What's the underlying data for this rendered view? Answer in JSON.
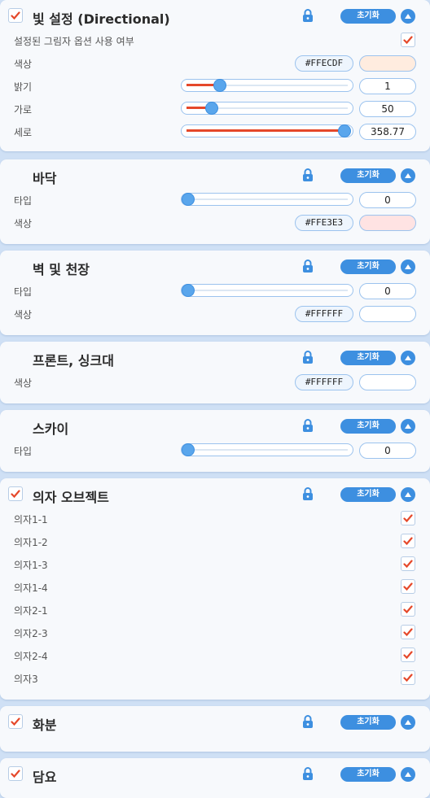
{
  "reset_label": "초기화",
  "lighting": {
    "title": "빛 설정 (Directional)",
    "enabled": true,
    "shadow_option_label": "설정된 그림자 옵션 사용 여부",
    "shadow_option_checked": true,
    "color_label": "색상",
    "color_hex": "#FFECDF",
    "brightness_label": "밝기",
    "brightness_value": "1",
    "horizontal_label": "가로",
    "horizontal_value": "50",
    "vertical_label": "세로",
    "vertical_value": "358.77"
  },
  "floor": {
    "title": "바닥",
    "type_label": "타입",
    "type_value": "0",
    "color_label": "색상",
    "color_hex": "#FFE3E3"
  },
  "wall": {
    "title": "벽 및 천장",
    "type_label": "타입",
    "type_value": "0",
    "color_label": "색상",
    "color_hex": "#FFFFFF"
  },
  "front": {
    "title": "프론트, 싱크대",
    "color_label": "색상",
    "color_hex": "#FFFFFF"
  },
  "sky": {
    "title": "스카이",
    "type_label": "타입",
    "type_value": "0"
  },
  "chairs": {
    "title": "의자 오브젝트",
    "enabled": true,
    "items": [
      {
        "label": "의자1-1",
        "checked": true
      },
      {
        "label": "의자1-2",
        "checked": true
      },
      {
        "label": "의자1-3",
        "checked": true
      },
      {
        "label": "의자1-4",
        "checked": true
      },
      {
        "label": "의자2-1",
        "checked": true
      },
      {
        "label": "의자2-3",
        "checked": true
      },
      {
        "label": "의자2-4",
        "checked": true
      },
      {
        "label": "의자3",
        "checked": true
      }
    ]
  },
  "flowerpot": {
    "title": "화분",
    "enabled": true
  },
  "fence": {
    "title": "담요",
    "enabled": true
  },
  "colors": {
    "accent": "#3D8FE0",
    "slider_fill": "#E5482A",
    "check": "#E5482A"
  },
  "slider_levels": {
    "brightness": 0.19,
    "horizontal": 0.14,
    "vertical": 1.0,
    "floor_type": 0.0,
    "wall_type": 0.0,
    "sky_type": 0.0
  }
}
